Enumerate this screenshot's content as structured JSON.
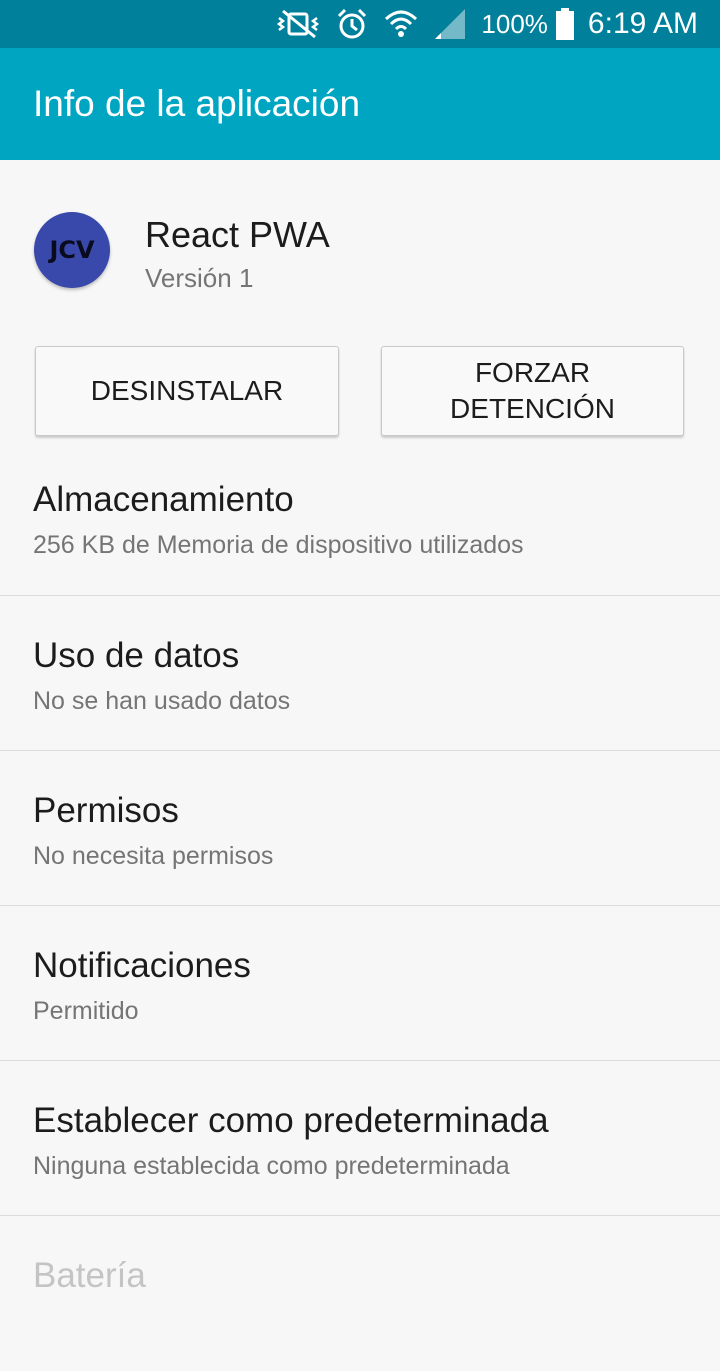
{
  "status_bar": {
    "battery_percent": "100%",
    "time": "6:19 AM",
    "icons": [
      "vibrate-mute-icon",
      "alarm-icon",
      "wifi-icon",
      "signal-icon",
      "battery-icon"
    ]
  },
  "app_bar": {
    "title": "Info de la aplicación"
  },
  "app": {
    "icon_text": "JCV",
    "name": "React PWA",
    "version": "Versión 1",
    "icon_color": "#3949ab"
  },
  "buttons": {
    "uninstall": "DESINSTALAR",
    "force_stop": "FORZAR\nDETENCIÓN"
  },
  "settings": [
    {
      "title": "Almacenamiento",
      "subtitle": "256 KB de Memoria de dispositivo utilizados"
    },
    {
      "title": "Uso de datos",
      "subtitle": "No se han usado datos"
    },
    {
      "title": "Permisos",
      "subtitle": "No necesita permisos"
    },
    {
      "title": "Notificaciones",
      "subtitle": "Permitido"
    },
    {
      "title": "Establecer como predeterminada",
      "subtitle": "Ninguna establecida como predeterminada"
    },
    {
      "title": "Batería",
      "subtitle": ""
    }
  ],
  "colors": {
    "status_bar": "#00809b",
    "app_bar": "#00a5c2",
    "background": "#f7f7f7"
  }
}
